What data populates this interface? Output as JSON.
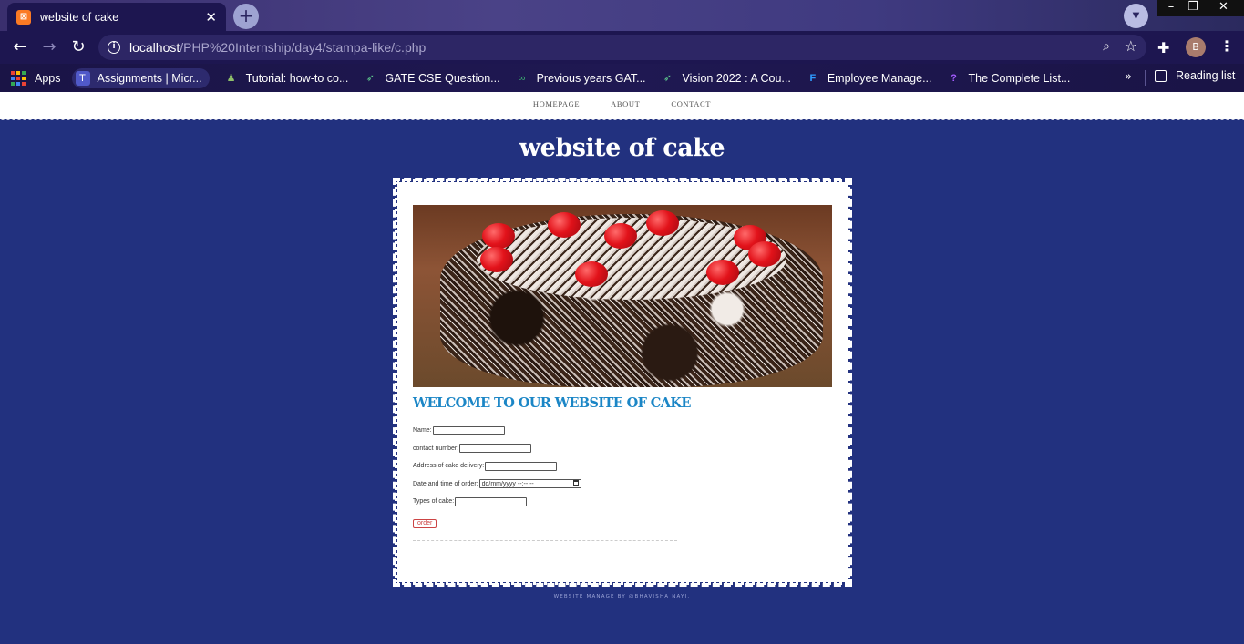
{
  "browser": {
    "tab_title": "website of cake",
    "tab_close": "✕",
    "new_tab": "+",
    "url_host": "localhost",
    "url_path": "/PHP%20Internship/day4/stampa-like/c.php",
    "profile_initial": "B",
    "window_controls": {
      "minimize": "–",
      "maximize": "❐",
      "close": "✕"
    }
  },
  "bookmarks": {
    "items": [
      {
        "label": "Apps",
        "icon": "apps-icon"
      },
      {
        "label": "Assignments | Micr...",
        "icon": "teams-icon"
      },
      {
        "label": "Tutorial: how-to co...",
        "icon": "tutorial-icon"
      },
      {
        "label": "GATE CSE Question...",
        "icon": "rocket-icon"
      },
      {
        "label": "Previous years GAT...",
        "icon": "link-icon"
      },
      {
        "label": "Vision 2022 : A Cou...",
        "icon": "rocket-icon"
      },
      {
        "label": "Employee Manage...",
        "icon": "f-icon"
      },
      {
        "label": "The Complete List...",
        "icon": "question-icon"
      }
    ],
    "more": "»",
    "reading_list": "Reading list"
  },
  "page": {
    "nav": [
      "HOMEPAGE",
      "ABOUT",
      "CONTACT"
    ],
    "title": "website of cake",
    "welcome": "WELCOME TO OUR WEBSITE OF CAKE",
    "form": {
      "name_label": "Name:",
      "contact_label": "contact number:",
      "address_label": "Address of cake delivery:",
      "datetime_label": "Date and time of order:",
      "datetime_placeholder": "dd/mm/yyyy --:-- --",
      "type_label": "Types of cake:",
      "order_button": "order"
    },
    "footer": "WEBSITE MANAGE BY @BHAVISHA NAYI."
  },
  "colors": {
    "page_background": "#22317f",
    "heading_blue": "#1b86c6",
    "tab_bar": "#1d1650"
  }
}
